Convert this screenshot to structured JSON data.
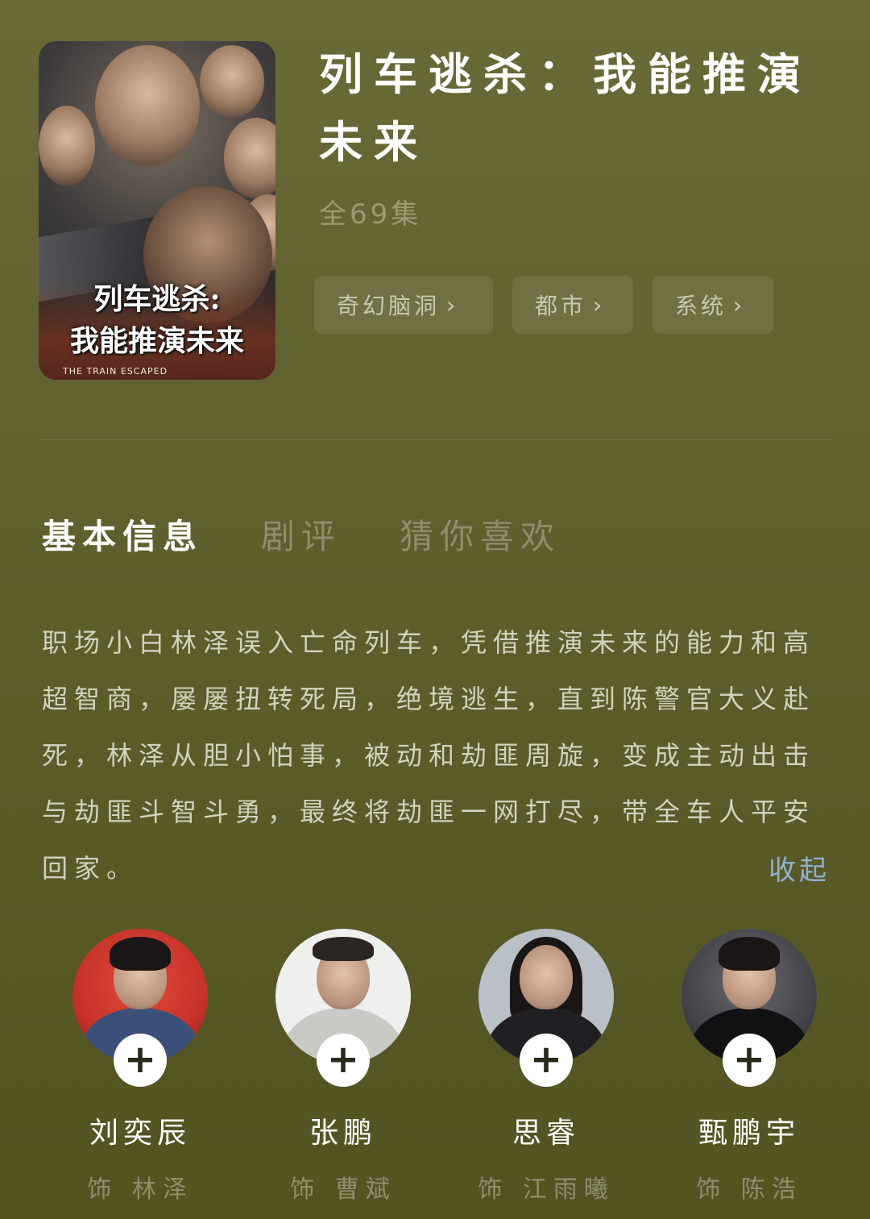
{
  "poster": {
    "title_line1": "列车逃杀:",
    "title_line2": "我能推演未来",
    "subtitle": "THE TRAIN ESCAPED"
  },
  "header": {
    "title": "列车逃杀：我能推演未来",
    "episodes": "全69集",
    "tags": [
      {
        "label": "奇幻脑洞"
      },
      {
        "label": "都市"
      },
      {
        "label": "系统"
      }
    ]
  },
  "tabs": [
    {
      "label": "基本信息",
      "active": true
    },
    {
      "label": "剧评",
      "active": false
    },
    {
      "label": "猜你喜欢",
      "active": false
    }
  ],
  "synopsis": {
    "text": "职场小白林泽误入亡命列车，凭借推演未来的能力和高超智商，屡屡扭转死局，绝境逃生，直到陈警官大义赴死，林泽从胆小怕事，被动和劫匪周旋，变成主动出击与劫匪斗智斗勇，最终将劫匪一网打尽，带全车人平安回家。",
    "collapse_label": "收起"
  },
  "cast": [
    {
      "name": "刘奕辰",
      "role": "饰 林泽"
    },
    {
      "name": "张鹏",
      "role": "饰 曹斌"
    },
    {
      "name": "思睿",
      "role": "饰 江雨曦"
    },
    {
      "name": "甄鹏宇",
      "role": "饰 陈浩"
    }
  ],
  "icons": {
    "chevron": "chevron-right-icon",
    "plus": "plus-icon"
  }
}
